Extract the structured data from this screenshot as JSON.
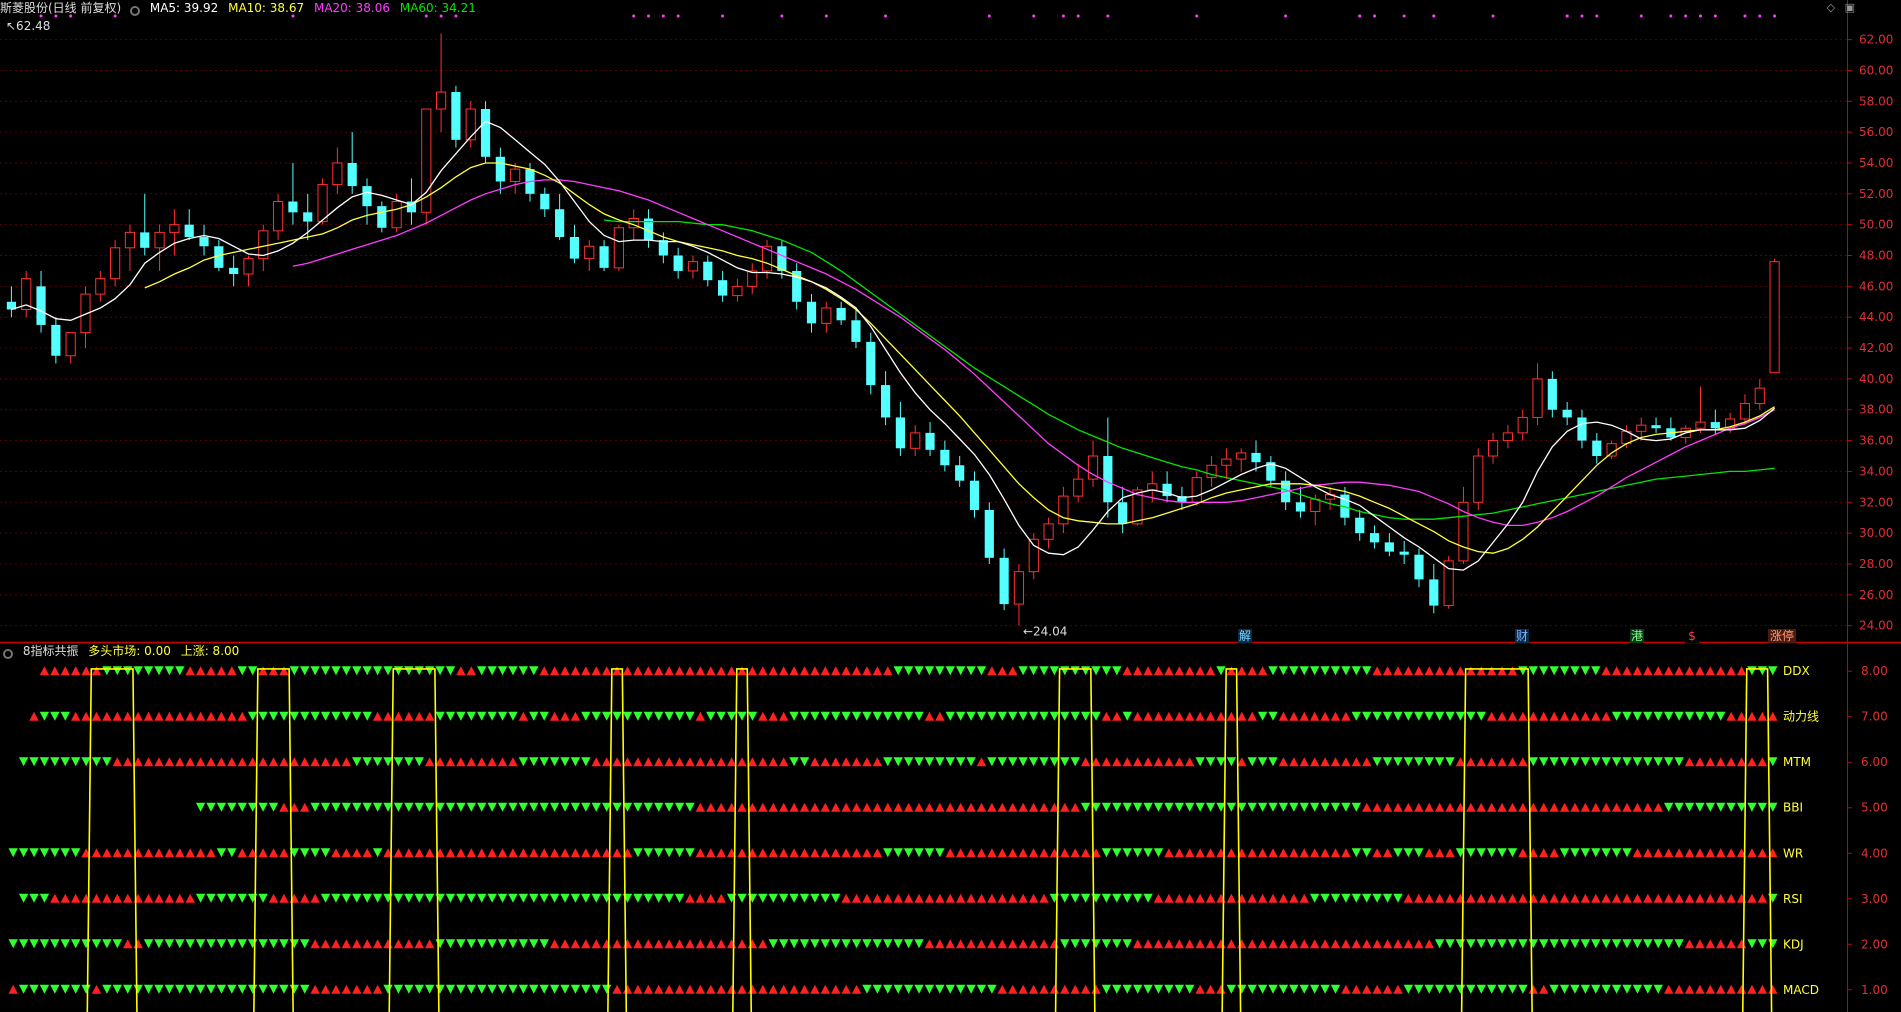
{
  "main_header": {
    "stock": "斯菱股份(日线 前复权)",
    "ma5": "MA5: 39.92",
    "ma10": "MA10: 38.67",
    "ma20": "MA20: 38.06",
    "ma60": "MA60: 34.21"
  },
  "sub_header": {
    "title": "8指标共振",
    "market": "多头市场: 0.00",
    "up": "上涨: 8.00"
  },
  "colors": {
    "up": "#ff3030",
    "down": "#54ffff",
    "ma5": "#ffffff",
    "ma10": "#ffff3c",
    "ma20": "#ff3cff",
    "ma60": "#00e600",
    "axis": "#c80000",
    "signal_up": "#ff2020",
    "signal_down": "#30ff30",
    "resonance": "#ffff00"
  },
  "icons": [
    "collapse-icon",
    "diamond-icon",
    "window-icon"
  ],
  "price_axis": {
    "ticks": [
      "62.00",
      "60.00",
      "58.00",
      "56.00",
      "54.00",
      "52.00",
      "50.00",
      "48.00",
      "46.00",
      "44.00",
      "42.00",
      "40.00",
      "38.00",
      "36.00",
      "34.00",
      "32.00",
      "30.00",
      "28.00",
      "26.00",
      "24.00"
    ],
    "min": 23.2,
    "max": 63.4
  },
  "annotations": {
    "high": "62.48",
    "low": "24.04",
    "events": [
      "解",
      "财",
      "港",
      "$",
      "涨停"
    ]
  },
  "indicator_axis": {
    "ticks": [
      "8.00",
      "7.00",
      "6.00",
      "5.00",
      "4.00",
      "3.00",
      "2.00",
      "1.00"
    ],
    "min": 0.6,
    "max": 8.4
  },
  "chart_data": {
    "type": "candlestick",
    "bars": 120,
    "ohlc": [
      [
        45,
        46,
        44,
        44.5
      ],
      [
        44.5,
        47,
        44,
        46.5
      ],
      [
        46,
        47,
        43,
        43.5
      ],
      [
        43.5,
        44,
        41,
        41.5
      ],
      [
        41.5,
        43,
        41,
        43
      ],
      [
        43,
        46,
        42,
        45.5
      ],
      [
        45.5,
        47,
        45,
        46.5
      ],
      [
        46.5,
        49,
        46,
        48.5
      ],
      [
        48.5,
        50,
        47,
        49.5
      ],
      [
        49.5,
        52,
        48,
        48.5
      ],
      [
        48.5,
        50,
        47,
        49.5
      ],
      [
        49.5,
        51,
        48,
        50
      ],
      [
        50,
        51,
        49,
        49.2
      ],
      [
        49.2,
        50,
        48,
        48.6
      ],
      [
        48.6,
        49,
        47,
        47.2
      ],
      [
        47.2,
        48,
        46,
        46.8
      ],
      [
        46.8,
        48,
        46,
        47.8
      ],
      [
        47.8,
        50,
        47,
        49.6
      ],
      [
        49.6,
        52,
        49,
        51.5
      ],
      [
        51.5,
        54,
        50,
        50.8
      ],
      [
        50.8,
        52,
        49,
        50.2
      ],
      [
        50.2,
        53,
        50,
        52.6
      ],
      [
        52.6,
        55,
        52,
        54
      ],
      [
        54,
        56,
        52,
        52.5
      ],
      [
        52.5,
        53,
        50,
        51.2
      ],
      [
        51.2,
        51.5,
        49.5,
        49.8
      ],
      [
        49.8,
        52,
        49.5,
        51.5
      ],
      [
        51.5,
        53,
        50,
        50.8
      ],
      [
        50.8,
        55,
        50,
        57.5
      ],
      [
        57.5,
        62.4,
        56,
        58.6
      ],
      [
        58.6,
        59,
        55,
        55.5
      ],
      [
        55.5,
        58,
        55,
        57.5
      ],
      [
        57.5,
        58,
        54,
        54.4
      ],
      [
        54.4,
        55,
        52,
        52.8
      ],
      [
        52.8,
        54,
        52,
        53.6
      ],
      [
        53.6,
        54,
        51.5,
        52
      ],
      [
        52,
        52.4,
        50.5,
        51
      ],
      [
        51,
        52,
        49,
        49.2
      ],
      [
        49.2,
        50,
        47.5,
        47.8
      ],
      [
        47.8,
        49,
        47,
        48.6
      ],
      [
        48.6,
        49,
        47,
        47.2
      ],
      [
        47.2,
        50,
        47,
        49.8
      ],
      [
        49.8,
        51,
        49,
        50.4
      ],
      [
        50.4,
        51,
        48.5,
        49
      ],
      [
        49,
        49.5,
        47.5,
        48
      ],
      [
        48,
        48.5,
        46.5,
        47
      ],
      [
        47,
        48,
        46.5,
        47.6
      ],
      [
        47.6,
        48,
        46,
        46.4
      ],
      [
        46.4,
        47,
        45,
        45.4
      ],
      [
        45.4,
        46.5,
        45,
        46
      ],
      [
        46,
        47.5,
        45.5,
        47
      ],
      [
        47,
        49,
        46.5,
        48.6
      ],
      [
        48.6,
        49,
        46.5,
        47
      ],
      [
        47,
        47.5,
        44.5,
        45
      ],
      [
        45,
        45.5,
        43,
        43.6
      ],
      [
        43.6,
        45,
        43,
        44.6
      ],
      [
        44.6,
        45,
        43.5,
        43.8
      ],
      [
        43.8,
        44.5,
        42,
        42.4
      ],
      [
        42.4,
        43,
        39,
        39.6
      ],
      [
        39.6,
        40.5,
        37,
        37.5
      ],
      [
        37.5,
        38.5,
        35,
        35.5
      ],
      [
        35.5,
        37,
        35,
        36.5
      ],
      [
        36.5,
        37.2,
        35,
        35.4
      ],
      [
        35.4,
        36,
        34,
        34.4
      ],
      [
        34.4,
        35,
        33,
        33.4
      ],
      [
        33.4,
        34,
        31,
        31.5
      ],
      [
        31.5,
        32,
        28,
        28.4
      ],
      [
        28.4,
        29,
        25,
        25.4
      ],
      [
        25.4,
        28,
        24,
        27.5
      ],
      [
        27.5,
        30,
        27,
        29.6
      ],
      [
        29.6,
        31,
        29,
        30.6
      ],
      [
        30.6,
        33,
        30,
        32.4
      ],
      [
        32.4,
        34.5,
        32,
        33.5
      ],
      [
        33.5,
        36,
        33,
        35
      ],
      [
        35,
        37.5,
        31,
        32
      ],
      [
        32,
        33,
        30,
        30.6
      ],
      [
        30.6,
        33,
        30.5,
        32.8
      ],
      [
        32.8,
        34,
        32,
        33.2
      ],
      [
        33.2,
        34,
        32,
        32.4
      ],
      [
        32.4,
        33,
        31.5,
        32
      ],
      [
        32,
        34,
        31.8,
        33.6
      ],
      [
        33.6,
        35,
        33,
        34.4
      ],
      [
        34.4,
        35.5,
        33.5,
        34.8
      ],
      [
        34.8,
        35.5,
        34,
        35.2
      ],
      [
        35.2,
        36,
        34,
        34.6
      ],
      [
        34.6,
        35,
        33,
        33.4
      ],
      [
        33.4,
        34,
        31.5,
        32
      ],
      [
        32,
        33,
        31,
        31.4
      ],
      [
        31.4,
        32.5,
        30.5,
        32.2
      ],
      [
        32.2,
        33,
        31.5,
        32.5
      ],
      [
        32.5,
        33,
        30.5,
        31
      ],
      [
        31,
        31.5,
        29.5,
        30
      ],
      [
        30,
        30.5,
        29,
        29.4
      ],
      [
        29.4,
        30,
        28.5,
        28.8
      ],
      [
        28.8,
        29.5,
        28,
        28.6
      ],
      [
        28.6,
        29,
        26.5,
        27
      ],
      [
        27,
        28,
        24.8,
        25.3
      ],
      [
        25.3,
        28.5,
        25.1,
        28.2
      ],
      [
        28.2,
        33,
        28,
        32
      ],
      [
        32,
        35.5,
        31.5,
        35
      ],
      [
        35,
        36.5,
        34.5,
        36
      ],
      [
        36,
        37,
        35.5,
        36.5
      ],
      [
        36.5,
        38,
        36,
        37.5
      ],
      [
        37.5,
        41,
        37,
        40
      ],
      [
        40,
        40.5,
        37.5,
        38
      ],
      [
        38,
        38.5,
        37,
        37.5
      ],
      [
        37.5,
        38,
        35.5,
        36
      ],
      [
        36,
        36.5,
        34.5,
        35
      ],
      [
        35,
        36,
        34.8,
        35.8
      ],
      [
        35.8,
        37,
        35.5,
        36.6
      ],
      [
        36.6,
        37.5,
        36,
        37
      ],
      [
        37,
        37.5,
        36.5,
        36.8
      ],
      [
        36.8,
        37.5,
        36,
        36.2
      ],
      [
        36.2,
        37,
        35.8,
        36.8
      ],
      [
        36.8,
        39.5,
        36.5,
        37.2
      ],
      [
        37.2,
        38,
        36.4,
        36.8
      ],
      [
        36.8,
        37.8,
        36.5,
        37.4
      ],
      [
        37.4,
        39,
        37,
        38.4
      ],
      [
        38.4,
        40,
        38,
        39.4
      ],
      [
        40.4,
        47.8,
        40.4,
        47.6
      ]
    ],
    "ma5": [
      44.5,
      44.8,
      44.4,
      43.9,
      43.8,
      44.2,
      44.6,
      45.2,
      46.1,
      47.5,
      48.2,
      48.8,
      49.1,
      49.3,
      49.1,
      48.6,
      48.1,
      48,
      48.3,
      48.8,
      49.5,
      50.3,
      51.1,
      51.8,
      52.1,
      51.9,
      51.6,
      51.3,
      52.1,
      53.5,
      54.6,
      55.7,
      56.7,
      56.3,
      55.5,
      54.7,
      53.9,
      52.8,
      51.5,
      50.2,
      49.3,
      48.9,
      49,
      49,
      48.9,
      48.9,
      48.6,
      48.2,
      47.7,
      47.2,
      46.9,
      46.9,
      46.8,
      46.6,
      46.3,
      45.9,
      45.3,
      44.6,
      43.4,
      41.9,
      40.4,
      39.1,
      38,
      37.1,
      36.1,
      35.1,
      33.8,
      32.2,
      30.5,
      29.2,
      28.7,
      28.6,
      29.1,
      30.2,
      31.4,
      32.3,
      32.6,
      32.8,
      32.6,
      32.3,
      32.4,
      32.8,
      33.3,
      33.8,
      34.2,
      34.5,
      34.2,
      33.6,
      33,
      32.5,
      32.2,
      31.8,
      31.1,
      30.4,
      29.7,
      29.1,
      28.4,
      27.7,
      27.6,
      28.2,
      29.4,
      30.6,
      32,
      34,
      35.6,
      36.6,
      37.1,
      37.2,
      37,
      36.6,
      36.1,
      36,
      36.1,
      36.5,
      36.7,
      36.7,
      36.7,
      36.8,
      37.3,
      38.1
    ],
    "ma10": [
      null,
      null,
      null,
      null,
      null,
      null,
      null,
      null,
      null,
      45.9,
      46.3,
      46.8,
      47.2,
      47.7,
      48,
      48.2,
      48.4,
      48.6,
      48.8,
      49,
      49.2,
      49.4,
      49.8,
      50.3,
      50.6,
      50.8,
      51,
      51.3,
      51.8,
      52.4,
      53.1,
      53.7,
      54,
      54,
      53.8,
      53.6,
      53.2,
      52.7,
      52,
      51.3,
      50.7,
      50.3,
      50,
      49.6,
      49.2,
      48.9,
      48.7,
      48.5,
      48.3,
      48,
      47.8,
      47.5,
      47.1,
      46.7,
      46.3,
      45.8,
      45.2,
      44.5,
      43.6,
      42.6,
      41.6,
      40.6,
      39.6,
      38.6,
      37.6,
      36.5,
      35.4,
      34.3,
      33.2,
      32.3,
      31.5,
      31,
      30.8,
      30.7,
      30.6,
      30.6,
      30.8,
      31,
      31.3,
      31.6,
      31.9,
      32.3,
      32.6,
      32.8,
      33,
      33.2,
      33.2,
      33.2,
      33.1,
      32.9,
      32.7,
      32.4,
      32,
      31.6,
      31.1,
      30.6,
      30.1,
      29.5,
      29.1,
      28.8,
      28.7,
      29,
      29.6,
      30.4,
      31.4,
      32.4,
      33.4,
      34.4,
      35.2,
      35.8,
      36.2,
      36.4,
      36.5,
      36.6,
      36.7,
      36.7,
      36.9,
      37.2,
      37.6,
      38.2
    ],
    "ma20": [
      null,
      null,
      null,
      null,
      null,
      null,
      null,
      null,
      null,
      null,
      null,
      null,
      null,
      null,
      null,
      null,
      null,
      null,
      null,
      47.3,
      47.5,
      47.8,
      48.1,
      48.4,
      48.7,
      49,
      49.3,
      49.7,
      50.1,
      50.6,
      51.1,
      51.6,
      52,
      52.3,
      52.6,
      52.8,
      52.9,
      52.9,
      52.8,
      52.6,
      52.4,
      52.2,
      51.9,
      51.6,
      51.2,
      50.8,
      50.4,
      50,
      49.6,
      49.2,
      48.8,
      48.4,
      48,
      47.6,
      47.2,
      46.8,
      46.3,
      45.8,
      45.2,
      44.6,
      44,
      43.3,
      42.6,
      41.9,
      41.1,
      40.3,
      39.4,
      38.5,
      37.6,
      36.7,
      35.8,
      35.1,
      34.4,
      33.8,
      33.3,
      32.9,
      32.5,
      32.3,
      32.1,
      32,
      32,
      32,
      32,
      32.1,
      32.3,
      32.5,
      32.7,
      32.9,
      33.1,
      33.2,
      33.3,
      33.3,
      33.2,
      33.1,
      32.9,
      32.7,
      32.3,
      31.9,
      31.4,
      31,
      30.7,
      30.5,
      30.5,
      30.7,
      31,
      31.4,
      31.9,
      32.4,
      33,
      33.6,
      34.1,
      34.6,
      35.1,
      35.6,
      36,
      36.4,
      36.8,
      37.1,
      37.5,
      38
    ],
    "ma60": [
      null,
      null,
      null,
      null,
      null,
      null,
      null,
      null,
      null,
      null,
      null,
      null,
      null,
      null,
      null,
      null,
      null,
      null,
      null,
      null,
      null,
      null,
      null,
      null,
      null,
      null,
      null,
      null,
      null,
      null,
      null,
      null,
      null,
      null,
      null,
      null,
      null,
      null,
      null,
      null,
      50.3,
      50.2,
      50.2,
      50.2,
      50.2,
      50.2,
      50.1,
      50,
      50,
      49.8,
      49.6,
      49.3,
      49,
      48.6,
      48.2,
      47.6,
      47,
      46.3,
      45.6,
      44.9,
      44.2,
      43.5,
      42.8,
      42.1,
      41.4,
      40.7,
      40.1,
      39.5,
      38.9,
      38.3,
      37.7,
      37.2,
      36.7,
      36.3,
      35.9,
      35.5,
      35.2,
      34.9,
      34.6,
      34.3,
      34.1,
      33.8,
      33.6,
      33.4,
      33.2,
      33,
      32.8,
      32.5,
      32.2,
      31.9,
      31.7,
      31.4,
      31.2,
      31,
      30.9,
      30.9,
      30.9,
      31,
      31.1,
      31.2,
      31.3,
      31.5,
      31.7,
      31.9,
      32.1,
      32.3,
      32.5,
      32.7,
      32.9,
      33.1,
      33.3,
      33.5,
      33.6,
      33.7,
      33.8,
      33.9,
      34,
      34,
      34.1,
      34.2
    ],
    "indicator": {
      "type": "signal-grid",
      "rows": [
        {
          "name": "DDX",
          "value": 8
        },
        {
          "name": "动力线",
          "value": 7
        },
        {
          "name": "MTM",
          "value": 6
        },
        {
          "name": "BBI",
          "value": 5
        },
        {
          "name": "WR",
          "value": 4
        },
        {
          "name": "RSI",
          "value": 3
        },
        {
          "name": "KDJ",
          "value": 2
        },
        {
          "name": "MACD",
          "value": 1
        }
      ],
      "resonance_bars": [
        [
          8,
          12
        ],
        [
          24,
          27
        ],
        [
          37,
          41
        ],
        [
          58,
          59
        ],
        [
          70,
          71
        ],
        [
          101,
          104
        ],
        [
          117,
          118
        ],
        [
          140,
          146
        ],
        [
          167,
          169
        ]
      ]
    }
  }
}
